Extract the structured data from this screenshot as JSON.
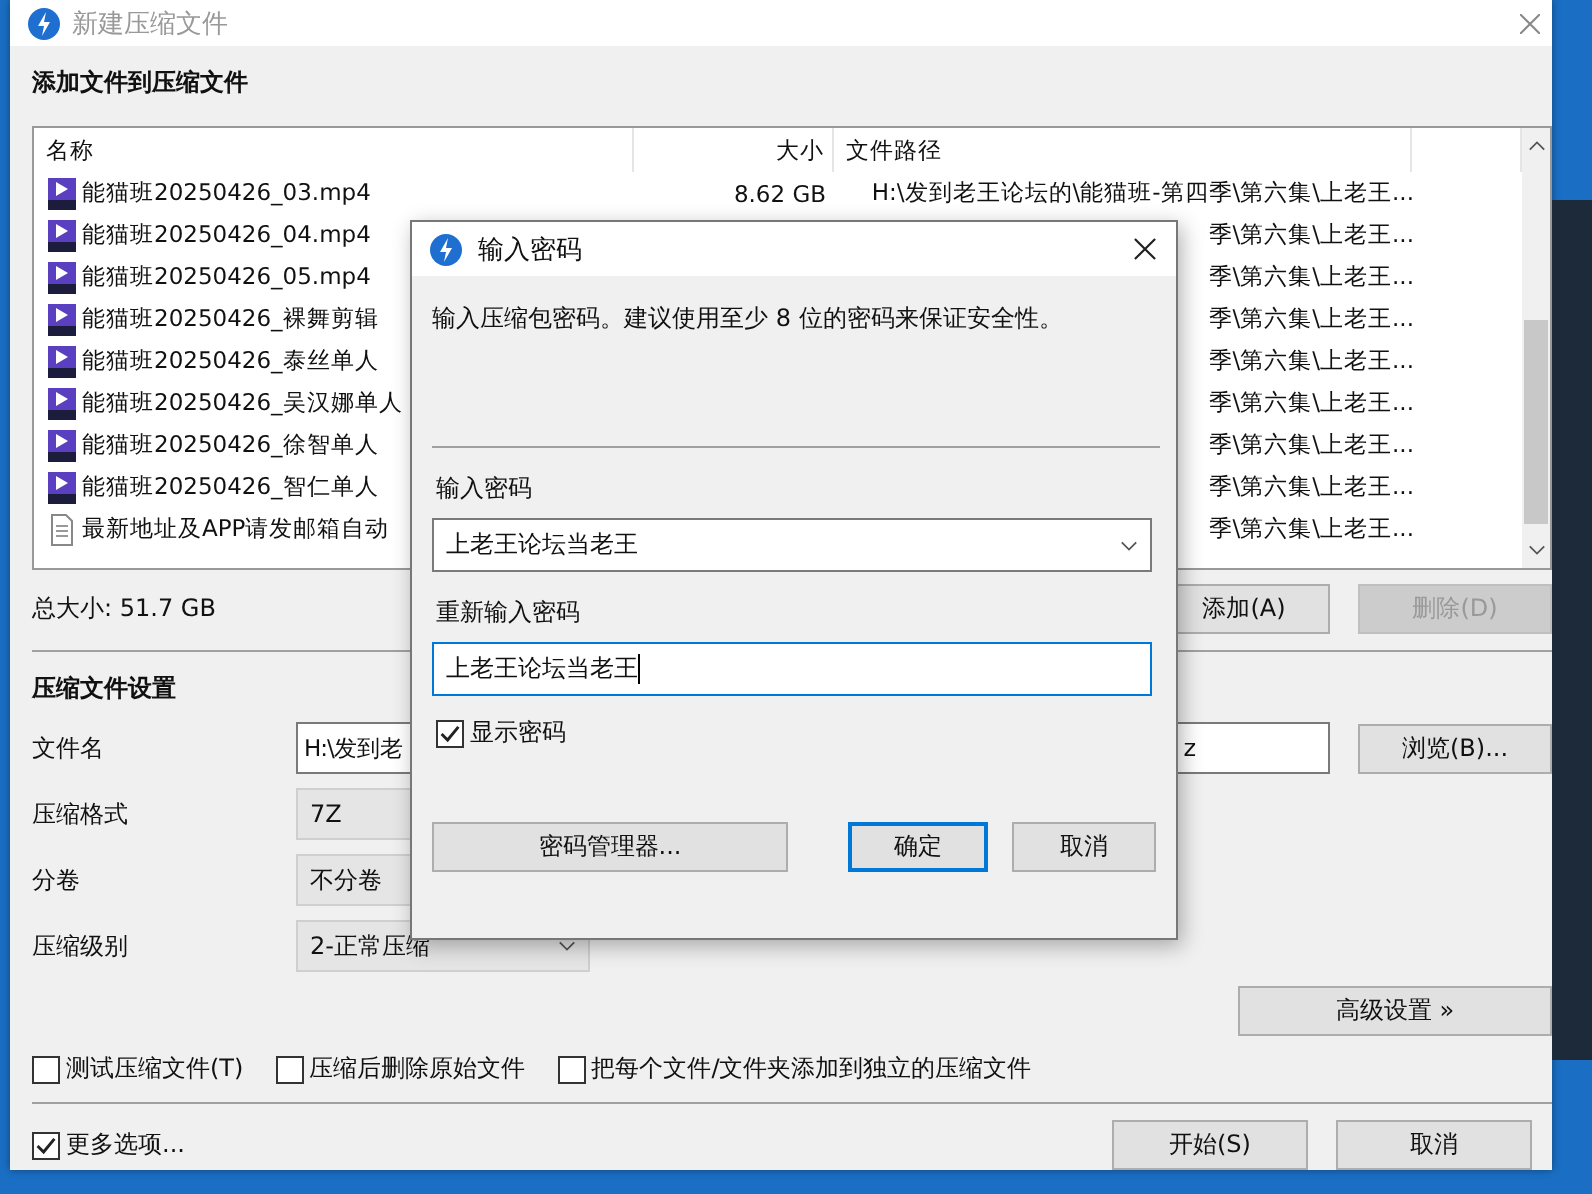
{
  "window": {
    "title": "新建压缩文件"
  },
  "files": {
    "heading": "添加文件到压缩文件",
    "columns": [
      "名称",
      "大小",
      "文件路径"
    ],
    "rows": [
      {
        "kind": "video",
        "name": "能猫班20250426_03.mp4",
        "size": "8.62 GB",
        "path": "H:\\发到老王论坛的\\能猫班-第四季\\第六集\\上老王..."
      },
      {
        "kind": "video",
        "name": "能猫班20250426_04.mp4",
        "path": "季\\第六集\\上老王..."
      },
      {
        "kind": "video",
        "name": "能猫班20250426_05.mp4",
        "path": "季\\第六集\\上老王..."
      },
      {
        "kind": "video",
        "name": "能猫班20250426_裸舞剪辑",
        "path": "季\\第六集\\上老王..."
      },
      {
        "kind": "video",
        "name": "能猫班20250426_泰丝单人",
        "path": "季\\第六集\\上老王..."
      },
      {
        "kind": "video",
        "name": "能猫班20250426_吴汉娜单人",
        "path": "季\\第六集\\上老王..."
      },
      {
        "kind": "video",
        "name": "能猫班20250426_徐智单人",
        "path": "季\\第六集\\上老王..."
      },
      {
        "kind": "video",
        "name": "能猫班20250426_智仁单人",
        "path": "季\\第六集\\上老王..."
      },
      {
        "kind": "text",
        "name": "最新地址及APP请发邮箱自动",
        "path": "季\\第六集\\上老王..."
      }
    ],
    "total": "总大小: 51.7 GB",
    "buttons": [
      {
        "label": "添加(A)",
        "disabled": false
      },
      {
        "label": "删除(D)",
        "disabled": true
      }
    ]
  },
  "settings": {
    "heading": "压缩文件设置",
    "fields": [
      {
        "kind": "path",
        "label": "文件名",
        "value": "H:\\发到老",
        "value_end": "z",
        "button": "浏览(B)..."
      },
      {
        "kind": "select",
        "label": "压缩格式",
        "value": "7Z"
      },
      {
        "kind": "select",
        "label": "分卷",
        "value": "不分卷"
      },
      {
        "kind": "dropdown",
        "label": "压缩级别",
        "value": "2-正常压缩",
        "button": "高级设置 »"
      }
    ],
    "options": [
      {
        "label": "测试压缩文件(T)",
        "checked": false
      },
      {
        "label": "压缩后删除原始文件",
        "checked": false
      },
      {
        "label": "把每个文件/文件夹添加到独立的压缩文件",
        "checked": false
      }
    ]
  },
  "footer": {
    "more_options": {
      "label": "更多选项...",
      "checked": true
    },
    "buttons": [
      "开始(S)",
      "取消"
    ]
  },
  "dialog": {
    "title": "输入密码",
    "description": "输入压缩包密码。建议使用至少 8 位的密码来保证安全性。",
    "password_label": "输入密码",
    "password": "上老王论坛当老王",
    "confirm_label": "重新输入密码",
    "confirm": "上老王论坛当老王",
    "show_password": {
      "label": "显示密码",
      "checked": true
    },
    "buttons": [
      {
        "label": "密码管理器...",
        "default": false
      },
      {
        "label": "确定",
        "default": true
      },
      {
        "label": "取消",
        "default": false
      }
    ]
  }
}
